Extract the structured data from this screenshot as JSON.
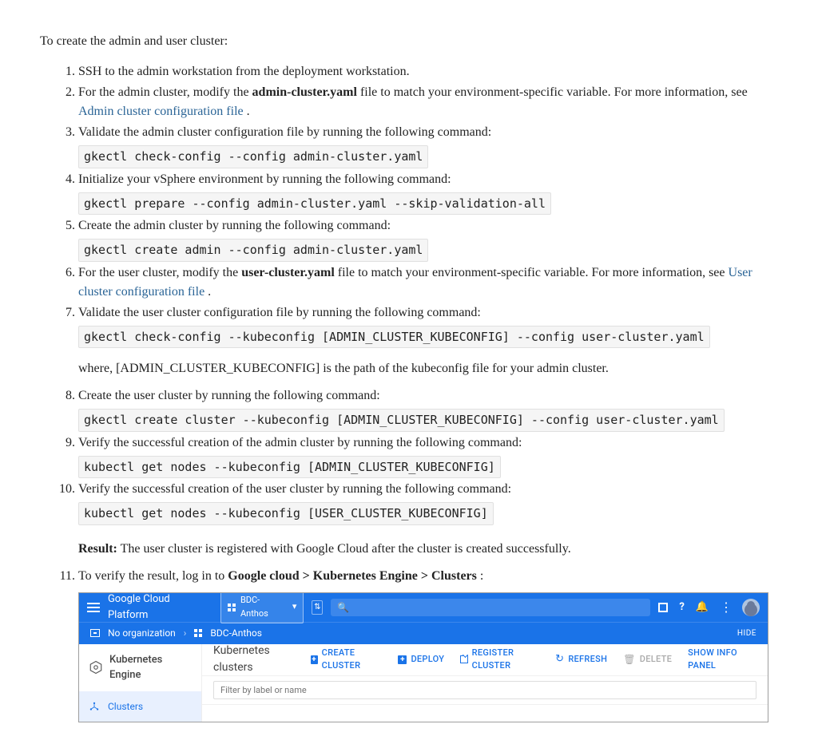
{
  "intro": "To create the admin and user cluster:",
  "steps": {
    "s1": "SSH to the admin workstation from the deployment workstation.",
    "s2a": "For the admin cluster, modify the ",
    "s2file": "admin-cluster.yaml",
    "s2b": " file to match your environment-specific variable. For more information, see ",
    "s2link": "Admin cluster configuration file",
    "s2c": " .",
    "s3": "Validate the admin cluster configuration file by running the following command:",
    "s3cmd": "gkectl check-config --config admin-cluster.yaml",
    "s4": "Initialize your vSphere environment by running the following command:",
    "s4cmd": "gkectl prepare --config admin-cluster.yaml --skip-validation-all",
    "s5": "Create the admin cluster by running the following command:",
    "s5cmd": "gkectl create admin --config admin-cluster.yaml",
    "s6a": "For the user cluster, modify the ",
    "s6file": "user-cluster.yaml",
    "s6b": " file to match your environment-specific variable. For more information, see ",
    "s6link": "User cluster configuration file",
    "s6c": " .",
    "s7": "Validate the user cluster configuration file by running the following command:",
    "s7cmd": "gkectl check-config --kubeconfig [ADMIN_CLUSTER_KUBECONFIG] --config user-cluster.yaml",
    "s7where": "where, [ADMIN_CLUSTER_KUBECONFIG] is the path of the kubeconfig file for your admin cluster.",
    "s8": "Create the user cluster by running the following command:",
    "s8cmd": "gkectl create cluster --kubeconfig [ADMIN_CLUSTER_KUBECONFIG] --config user-cluster.yaml",
    "s9": "Verify the successful creation of the admin cluster by running the following command:",
    "s9cmd": "kubectl get nodes --kubeconfig [ADMIN_CLUSTER_KUBECONFIG]",
    "s10": "Verify the successful creation of the user cluster by running the following command:",
    "s10cmd": "kubectl get nodes --kubeconfig [USER_CLUSTER_KUBECONFIG]",
    "s10r1": "Result:",
    "s10r2": " The user cluster is registered with Google Cloud after the cluster is created successfully.",
    "s11a": "To verify the result, log in to ",
    "s11b": "Google cloud > Kubernetes Engine > Clusters",
    "s11c": " :"
  },
  "gcp": {
    "platform": "Google Cloud Platform",
    "project": "BDC-Anthos",
    "bc_org": "No organization",
    "bc_proj": "BDC-Anthos",
    "hide": "HIDE",
    "side_header": "Kubernetes Engine",
    "side_clusters": "Clusters",
    "main_title": "Kubernetes clusters",
    "btn_create": "CREATE CLUSTER",
    "btn_deploy": "DEPLOY",
    "btn_register": "REGISTER CLUSTER",
    "btn_refresh": "REFRESH",
    "btn_delete": "DELETE",
    "show_info": "SHOW INFO PANEL",
    "filter_ph": "Filter by label or name"
  }
}
